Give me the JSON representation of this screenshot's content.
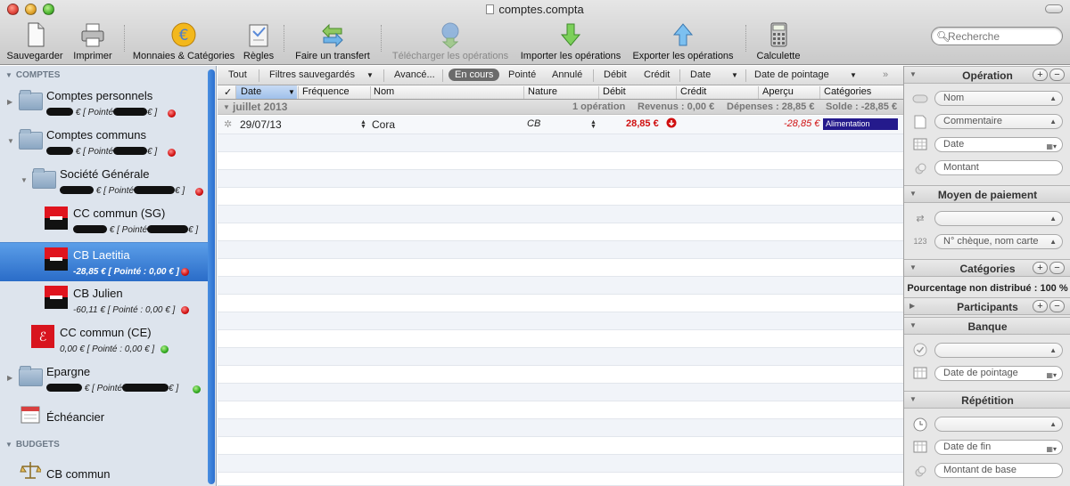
{
  "window": {
    "title": "comptes.compta"
  },
  "toolbar": {
    "save": "Sauvegarder",
    "print": "Imprimer",
    "currencies": "Monnaies & Catégories",
    "rules": "Règles",
    "transfer": "Faire un transfert",
    "download": "Télécharger les opérations",
    "import": "Importer les opérations",
    "export": "Exporter les opérations",
    "calc": "Calculette"
  },
  "search": {
    "placeholder": "Recherche"
  },
  "sidebar": {
    "comptes_header": "COMPTES",
    "budgets_header": "BUDGETS",
    "perso_name": "Comptes personnels",
    "communs_name": "Comptes communs",
    "sg_name": "Société Générale",
    "ccsg_name": "CC commun (SG)",
    "cbl_name": "CB Laetitia",
    "cbl_bal": "-28,85 € [ Pointé : 0,00 € ]",
    "cbj_name": "CB Julien",
    "cbj_bal": "-60,11 € [ Pointé : 0,00 € ]",
    "ccce_name": "CC commun (CE)",
    "ccce_bal": "0,00 € [ Pointé : 0,00 € ]",
    "epargne_name": "Epargne",
    "echeancier": "Échéancier",
    "budget_cb": "CB commun",
    "redacted_prefix": "€ [ Pointé",
    "redacted_suffix": "€ ]",
    "redacted_suffix2": "€ ]"
  },
  "filters": {
    "all": "Tout",
    "saved": "Filtres sauvegardés",
    "advanced": "Avancé...",
    "current": "En cours",
    "pointed": "Pointé",
    "cancelled": "Annulé",
    "debit": "Débit",
    "credit": "Crédit",
    "date": "Date",
    "pointdate": "Date de pointage"
  },
  "columns": {
    "check": "✓",
    "date": "Date",
    "freq": "Fréquence",
    "name": "Nom",
    "nature": "Nature",
    "debit": "Débit",
    "credit": "Crédit",
    "preview": "Aperçu",
    "categories": "Catégories"
  },
  "group": {
    "label": "juillet 2013",
    "count": "1 opération",
    "income": "Revenus : 0,00 €",
    "expenses": "Dépenses : 28,85 €",
    "balance": "Solde : -28,85 €"
  },
  "transactions": [
    {
      "date": "29/07/13",
      "name": "Cora",
      "nature": "CB",
      "debit": "28,85 €",
      "preview": "-28,85 €",
      "category": "Alimentation"
    }
  ],
  "panel": {
    "operation": "Opération",
    "name_field": "Nom",
    "comment_field": "Commentaire",
    "date_field": "Date",
    "amount_field": "Montant",
    "payment": "Moyen de paiement",
    "cheque_field": "N° chèque, nom carte",
    "categories": "Catégories",
    "undistributed": "Pourcentage non distribué : 100 %",
    "participants": "Participants",
    "bank": "Banque",
    "pointdate_field": "Date de pointage",
    "repetition": "Répétition",
    "enddate_field": "Date de fin",
    "baseamount_field": "Montant de base"
  },
  "colors": {
    "selection": "#2a6cc8",
    "debit": "#d01010",
    "category": "#241a8c"
  }
}
